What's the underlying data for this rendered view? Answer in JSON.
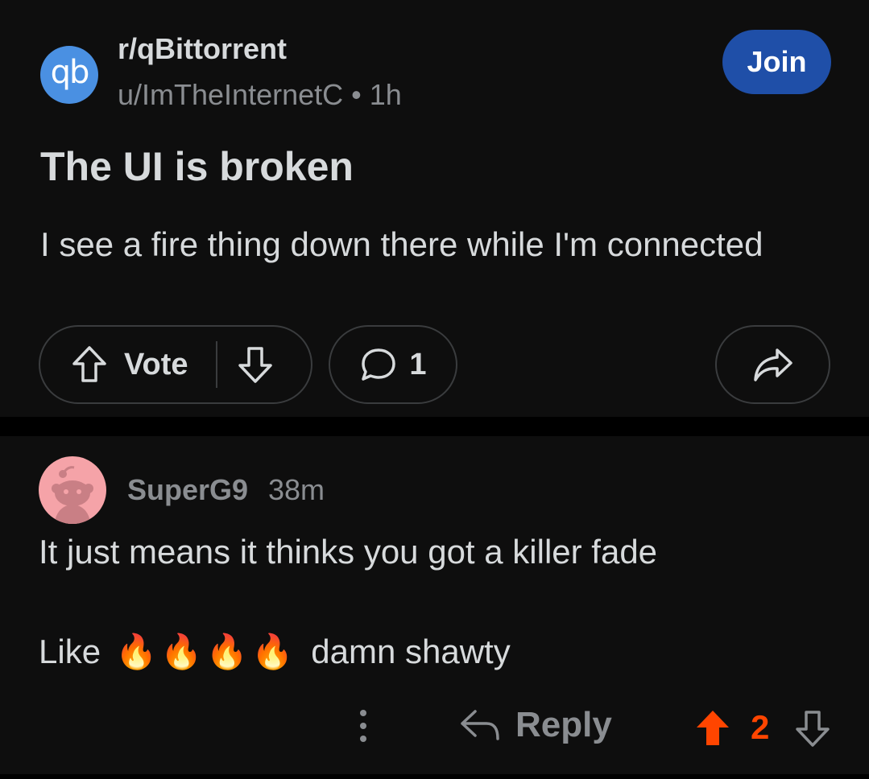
{
  "post": {
    "subreddit": "r/qBittorrent",
    "subreddit_icon_text": "qb",
    "author": "u/ImTheInternetC",
    "separator": "•",
    "time": "1h",
    "join_label": "Join",
    "title": "The UI is broken",
    "body": "I see a fire thing down there while I'm connected",
    "vote_label": "Vote",
    "comment_count": "1"
  },
  "comment": {
    "author": "SuperG9",
    "time": "38m",
    "line1": "It just means it thinks you got a killer fade",
    "line2_prefix": "Like",
    "fires": [
      "🔥",
      "🔥",
      "🔥",
      "🔥"
    ],
    "line2_suffix": "damn shawty",
    "reply_label": "Reply",
    "score": "2"
  },
  "colors": {
    "background": "#0e0e0e",
    "text": "#d7dadc",
    "muted": "#8a8d91",
    "join": "#1f4fa8",
    "upvoted": "#ff4500",
    "avatar": "#f5a3a8",
    "sub_icon": "#4a90e2"
  },
  "icons": {
    "upvote": "arrow-up-outline-icon",
    "downvote": "arrow-down-outline-icon",
    "comment": "speech-bubble-icon",
    "share": "share-arrow-icon",
    "more": "vertical-ellipsis-icon",
    "reply": "reply-arrow-icon",
    "upvoted": "arrow-up-filled-icon"
  }
}
